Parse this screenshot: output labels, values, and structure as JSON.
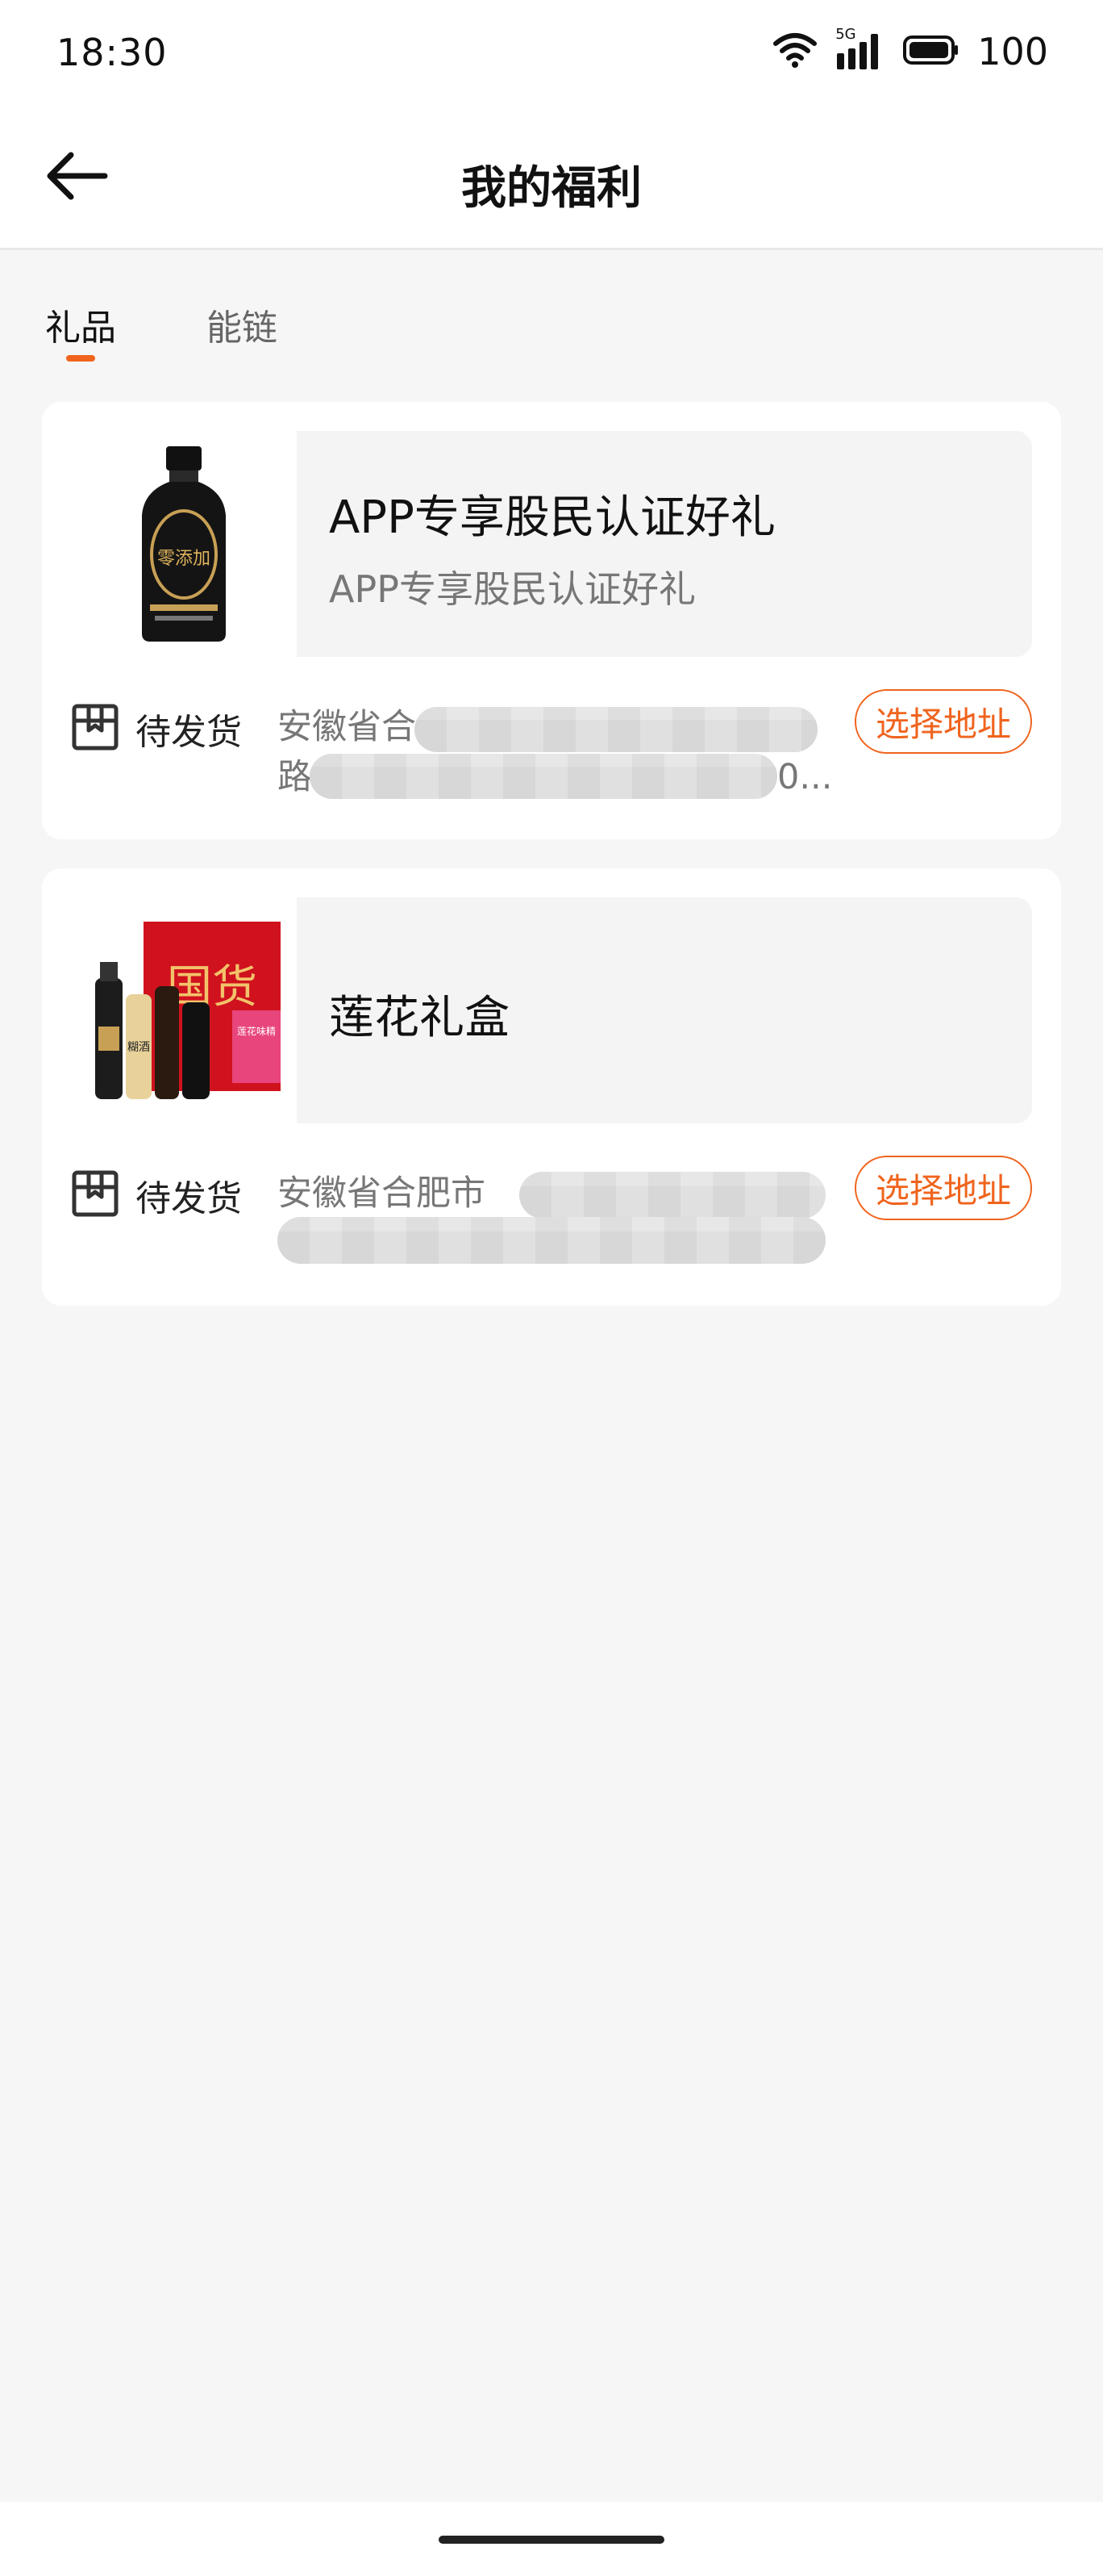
{
  "status_bar": {
    "time": "18:30",
    "network_label": "5G",
    "battery": "100"
  },
  "nav": {
    "title": "我的福利",
    "back_icon": "arrow-left-icon"
  },
  "tabs": [
    {
      "label": "礼品",
      "active": true
    },
    {
      "label": "能链",
      "active": false
    }
  ],
  "items": [
    {
      "title": "APP专享股民认证好礼",
      "subtitle": "APP专享股民认证好礼",
      "status": "待发货",
      "address_line1": "安徽省合",
      "address_line2": "路6",
      "address_tail": "0...",
      "action": "选择地址",
      "thumb_text": "零添加"
    },
    {
      "title": "莲花礼盒",
      "subtitle": "",
      "status": "待发货",
      "address_line1": "安徽省合肥市",
      "address_line2": "",
      "address_tail": "",
      "action": "选择地址",
      "thumb_text_a": "国货",
      "thumb_text_b": "糊酒",
      "thumb_text_c": "莲花味精"
    }
  ],
  "colors": {
    "accent": "#f0641e",
    "background": "#f6f6f6",
    "card": "#ffffff"
  }
}
